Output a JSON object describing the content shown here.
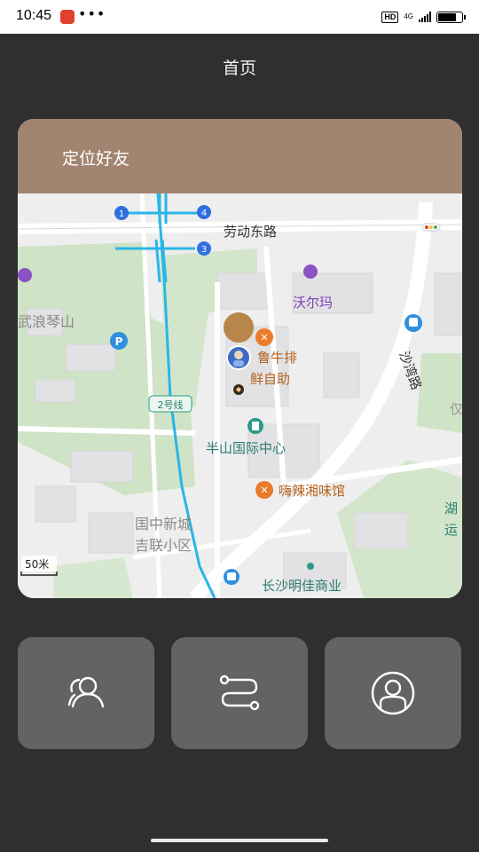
{
  "status_bar": {
    "time": "10:45",
    "dots": "•••",
    "hd": "HD",
    "network": "4G",
    "battery_level": 0.8
  },
  "header": {
    "title": "首页"
  },
  "card": {
    "title": "定位好友",
    "map": {
      "road_laodong": "劳动东路",
      "road_shawan": "沙湾路",
      "walmart": "沃尔玛",
      "wulangqin": "武浪琴山",
      "restaurant_1_line1": "鲁牛排",
      "restaurant_1_line2": "鲜自助",
      "banshan": "半山国际中心",
      "hai_la": "嗨辣湘味馆",
      "guozhong_1": "国中新城",
      "guozhong_2": "吉联小区",
      "mingjia": "长沙明佳商业",
      "metro_line": "2号线",
      "scale": "50米",
      "exit_1": "1",
      "exit_3": "3",
      "exit_4": "4",
      "edge_1": "湖",
      "edge_2": "运",
      "edge_3": "仅"
    }
  },
  "actions": {
    "friends_icon": "friends-icon",
    "route_icon": "route-icon",
    "profile_icon": "profile-icon"
  },
  "colors": {
    "background": "#2f2f2f",
    "header_brown": "#a28570",
    "button_gray": "#646361",
    "metro_blue": "#29b6e8"
  }
}
